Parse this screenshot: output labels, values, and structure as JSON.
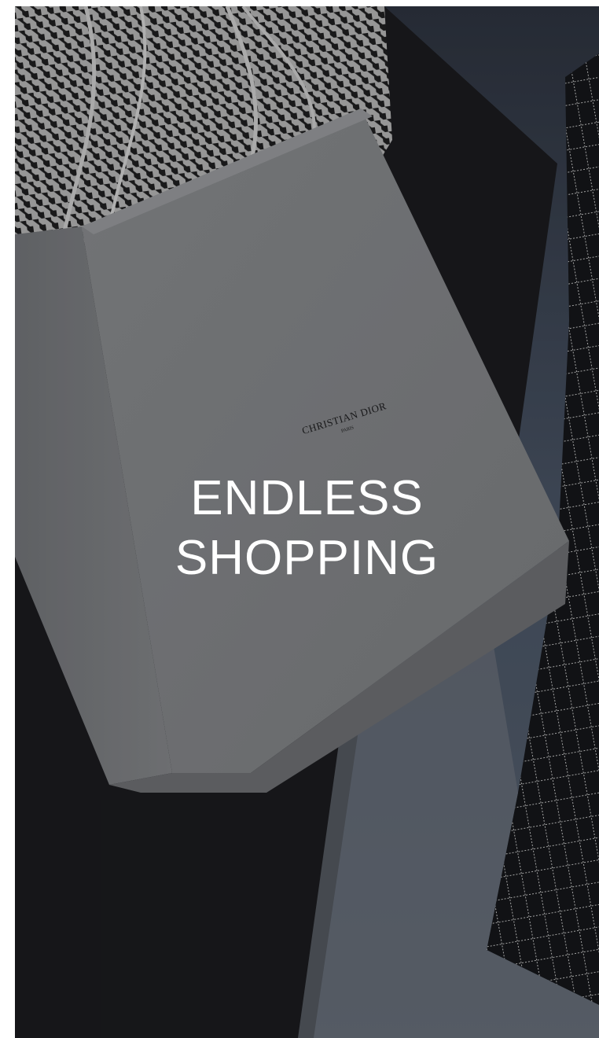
{
  "hero": {
    "headline_line1": "ENDLESS",
    "headline_line2": "SHOPPING",
    "bag_brand": "CHRISTIAN DIOR",
    "bag_brand_sub": "PARIS"
  },
  "colors": {
    "headline": "#ffffff",
    "bag": "#8d8f92",
    "background": "#2b2e33"
  }
}
